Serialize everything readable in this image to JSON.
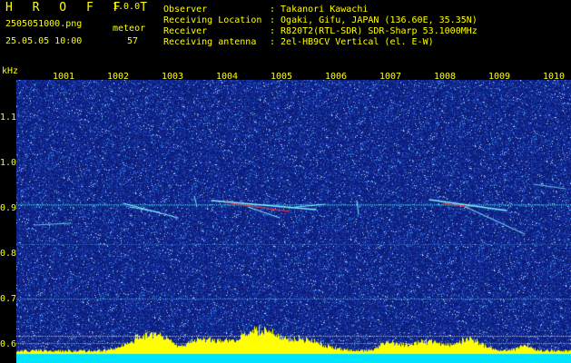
{
  "app": {
    "title": "H R O F F T",
    "version": "1.0.0",
    "file_name": "2505051000.png",
    "date_time": "25.05.05 10:00",
    "meteor_label": "meteor",
    "meteor_count": "57"
  },
  "station_info": [
    {
      "label": "Observer",
      "value": ": Takanori Kawachi"
    },
    {
      "label": "Receiving Location",
      "value": ": Ogaki, Gifu, JAPAN (136.60E, 35.35N)"
    },
    {
      "label": "Receiver",
      "value": ": R820T2(RTL-SDR) SDR-Sharp 53.1000MHz"
    },
    {
      "label": "Receiving antenna",
      "value": ": 2el-HB9CV Vertical (el. E-W)"
    }
  ],
  "spectrogram": {
    "y_unit": "kHz",
    "x_ticks": [
      "1001",
      "1002",
      "1003",
      "1004",
      "1005",
      "1006",
      "1007",
      "1008",
      "1009",
      "1010"
    ],
    "y_ticks": [
      "1.1",
      "1.0",
      "0.9",
      "0.8",
      "0.7",
      "0.6"
    ],
    "colors": {
      "background": "#000000",
      "noise_base": "#1a35a8",
      "signal_line": "#38d8e8",
      "echo_color": "#7ff0ff",
      "hot_color": "#ff4040",
      "activity_fill": "#ffff00",
      "baseline_fill": "#00e5ff",
      "text_color": "#ffff00"
    }
  }
}
